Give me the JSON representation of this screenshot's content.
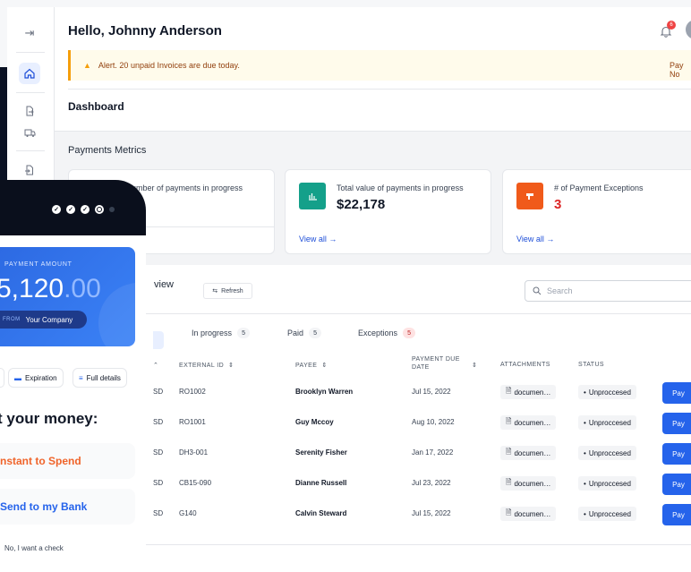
{
  "header": {
    "greeting": "Hello, Johnny Anderson",
    "notification_count": "6"
  },
  "alert": {
    "text": "Alert. 20 unpaid Invoices are due today.",
    "action": "Pay No"
  },
  "page_title": "Dashboard",
  "metrics": {
    "title": "Payments Metrics",
    "cards": [
      {
        "label": "umber of payments in progress",
        "value": "",
        "view": ""
      },
      {
        "label": "Total value of payments in progress",
        "value": "$22,178",
        "view": "View all",
        "color": "#14a08a"
      },
      {
        "label": "# of Payment Exceptions",
        "value": "3",
        "view": "View all",
        "color": "#f05a1a"
      }
    ]
  },
  "overview": {
    "title": "view",
    "refresh": "Refresh",
    "search_placeholder": "Search"
  },
  "tabs": [
    {
      "label": "In progress",
      "count": "5"
    },
    {
      "label": "Paid",
      "count": "5"
    },
    {
      "label": "Exceptions",
      "count": "5"
    }
  ],
  "table": {
    "headers": {
      "external_id": "EXTERNAL ID",
      "payee": "PAYEE",
      "due": "PAYMENT DUE",
      "due2": "DATE",
      "attachments": "ATTACHMENTS",
      "status": "STATUS"
    },
    "rows": [
      {
        "cur": "SD",
        "id": "RO1002",
        "payee": "Brooklyn Warren",
        "date": "Jul 15, 2022",
        "att": "documen…",
        "status": "Unproccesed",
        "action": "Pay"
      },
      {
        "cur": "SD",
        "id": "RO1001",
        "payee": "Guy Mccoy",
        "date": "Aug 10, 2022",
        "att": "documen…",
        "status": "Unproccesed",
        "action": "Pay"
      },
      {
        "cur": "SD",
        "id": "DH3-001",
        "payee": "Serenity Fisher",
        "date": "Jan 17, 2022",
        "att": "documen…",
        "status": "Unproccesed",
        "action": "Pay"
      },
      {
        "cur": "SD",
        "id": "CB15-090",
        "payee": "Dianne Russell",
        "date": "Jul 23, 2022",
        "att": "documen…",
        "status": "Unproccesed",
        "action": "Pay"
      },
      {
        "cur": "SD",
        "id": "G140",
        "payee": "Calvin Steward",
        "date": "Jul 15, 2022",
        "att": "documen…",
        "status": "Unproccesed",
        "action": "Pay"
      }
    ]
  },
  "phone": {
    "amount_label": "PAYMENT AMOUNT",
    "amount_main": "5,120",
    "amount_cents": ".00",
    "from_label": "FROM",
    "from_value": "Your Company",
    "chips": {
      "expiration": "Expiration",
      "details": "Full details"
    },
    "heading": "t your money:",
    "options": {
      "instant": "nstant to Spend",
      "bank": "Send to my Bank"
    },
    "check": "No, I want a check"
  },
  "colors": {
    "primary": "#2563eb",
    "alert_bg": "#fffbeb",
    "danger": "#dc2626"
  }
}
